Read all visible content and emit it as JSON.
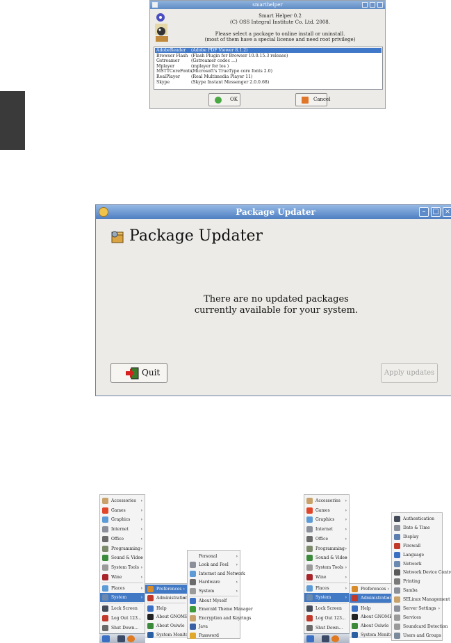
{
  "smarthelper": {
    "title": "smarthelper",
    "line1": "Smart Helper 0.2",
    "line2": "(C) OSS Integral Institute Co. Ltd. 2008.",
    "line3": "Please select a package to online install or uninstall.",
    "line4": "(most of them have a special license and need root privilege)",
    "packages": [
      {
        "name": "AdobeReader",
        "desc": "(Adobe PDF Viewer 8.1.2)"
      },
      {
        "name": "Browser Flash",
        "desc": "(Flash Plugin for Browser 10.0.15.3 release)"
      },
      {
        "name": "Gstreamer",
        "desc": "(Gstreamer codec ...)"
      },
      {
        "name": "Mplayer",
        "desc": "(mplayer for los )"
      },
      {
        "name": "MSTTCoreFonts",
        "desc": "(Microsoft's TrueType core fonts 2.0)"
      },
      {
        "name": "RealPlayer",
        "desc": "(Real Multimedia Player 11)"
      },
      {
        "name": "Skype",
        "desc": "(Skype Instant Messenger 2.0.0.68)"
      }
    ],
    "ok_label": "OK",
    "cancel_label": "Cancel"
  },
  "updater": {
    "title": "Package Updater",
    "heading": "Package Updater",
    "message_line1": "There are no updated packages",
    "message_line2": "currently available for your system.",
    "quit_label": "Quit",
    "apply_label": "Apply updates"
  },
  "menu_left": {
    "main": [
      {
        "label": "Accessories",
        "arrow": true,
        "color": "#c9a26b"
      },
      {
        "label": "Games",
        "arrow": true,
        "color": "#e0462a"
      },
      {
        "label": "Graphics",
        "arrow": true,
        "color": "#5c9bd6"
      },
      {
        "label": "Internet",
        "arrow": true,
        "color": "#8a8f99"
      },
      {
        "label": "Office",
        "arrow": true,
        "color": "#6b6b6b"
      },
      {
        "label": "Programming",
        "arrow": true,
        "color": "#7a8a6a"
      },
      {
        "label": "Sound & Video",
        "arrow": true,
        "color": "#3c8a3c"
      },
      {
        "label": "System Tools",
        "arrow": true,
        "color": "#9a9a9a"
      },
      {
        "label": "Wine",
        "arrow": true,
        "color": "#a8232a"
      }
    ],
    "places_label": "Places",
    "system_label": "System",
    "bottom": [
      {
        "label": "Lock Screen",
        "color": "#444b58"
      },
      {
        "label": "Log Out 123...",
        "color": "#c0392b"
      },
      {
        "label": "Shut Down...",
        "color": "#6b6b6b"
      }
    ],
    "system_sub": [
      {
        "label": "Preferences",
        "arrow": true,
        "color": "#d98b2a"
      },
      {
        "label": "Administration",
        "arrow": true,
        "color": "#c0392b"
      },
      {
        "label": "Help",
        "arrow": false,
        "color": "#3a6fc4"
      },
      {
        "label": "About GNOME",
        "arrow": false,
        "color": "#222222"
      },
      {
        "label": "About Osiwle",
        "arrow": false,
        "color": "#3a8a3a"
      },
      {
        "label": "System Monitor",
        "arrow": false,
        "color": "#2a5fa4"
      }
    ],
    "pref_sub": [
      {
        "label": "Personal",
        "arrow": true,
        "color": ""
      },
      {
        "label": "Look and Feel",
        "arrow": true,
        "color": "#8a8f99"
      },
      {
        "label": "Internet and Network",
        "arrow": true,
        "color": "#5c9bd6"
      },
      {
        "label": "Hardware",
        "arrow": true,
        "color": "#6b6b6b"
      },
      {
        "label": "System",
        "arrow": true,
        "color": "#9a9a9a"
      },
      {
        "label": "About Myself",
        "arrow": false,
        "color": "#3a6fc4"
      },
      {
        "label": "Emerald Theme Manager",
        "arrow": false,
        "color": "#3c9a3c"
      },
      {
        "label": "Encryption and Keyrings",
        "arrow": false,
        "color": "#c9a26b"
      },
      {
        "label": "Java",
        "arrow": false,
        "color": "#3a5fa4"
      },
      {
        "label": "Password",
        "arrow": false,
        "color": "#e0a82a"
      }
    ]
  },
  "menu_right": {
    "admin_sub": [
      {
        "label": "Authentication",
        "arrow": false,
        "color": "#444b58"
      },
      {
        "label": "Date & Time",
        "arrow": false,
        "color": "#8a8f99"
      },
      {
        "label": "Display",
        "arrow": false,
        "color": "#5c7fb0"
      },
      {
        "label": "Firewall",
        "arrow": false,
        "color": "#c0392b"
      },
      {
        "label": "Language",
        "arrow": false,
        "color": "#3a6fc4"
      },
      {
        "label": "Network",
        "arrow": false,
        "color": "#6b8ab0"
      },
      {
        "label": "Network Device Control",
        "arrow": false,
        "color": "#5a5a5a"
      },
      {
        "label": "Printing",
        "arrow": false,
        "color": "#7a7a7a"
      },
      {
        "label": "Samba",
        "arrow": false,
        "color": "#8a8f99"
      },
      {
        "label": "SELinux Management",
        "arrow": false,
        "color": "#c9a26b"
      },
      {
        "label": "Server Settings",
        "arrow": true,
        "color": "#8a8f99"
      },
      {
        "label": "Services",
        "arrow": false,
        "color": "#9a9a9a"
      },
      {
        "label": "Soundcard Detection",
        "arrow": false,
        "color": "#9a9a9a"
      },
      {
        "label": "Users and Groups",
        "arrow": false,
        "color": "#7a8a9a"
      }
    ]
  }
}
